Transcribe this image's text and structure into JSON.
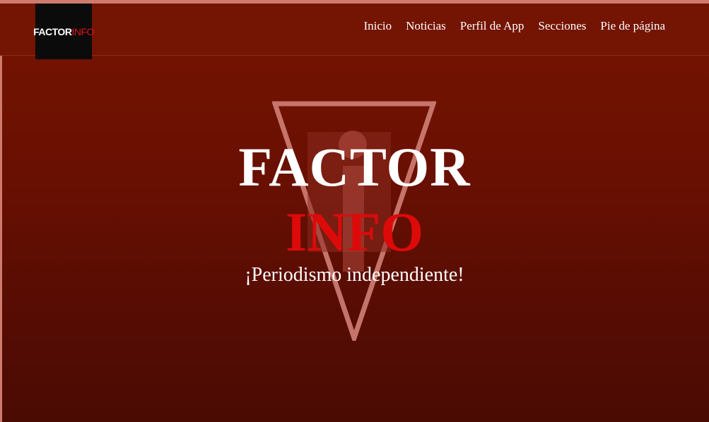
{
  "logo": {
    "part1": "FACTOR",
    "part2": "INFO"
  },
  "nav": {
    "items": [
      {
        "label": "Inicio"
      },
      {
        "label": "Noticias"
      },
      {
        "label": "Perfil de App"
      },
      {
        "label": "Secciones"
      },
      {
        "label": "Pie de página"
      }
    ]
  },
  "hero": {
    "title": "FACTOR",
    "subtitle": "INFO",
    "tagline": "¡Periodismo independiente!",
    "emblem_icon": "inverted-triangle-i-icon"
  },
  "colors": {
    "background": "#6a1002",
    "accent_red": "#dd0a0a",
    "frame": "#cf7a6c",
    "logo_bg": "#0b0b0b"
  }
}
